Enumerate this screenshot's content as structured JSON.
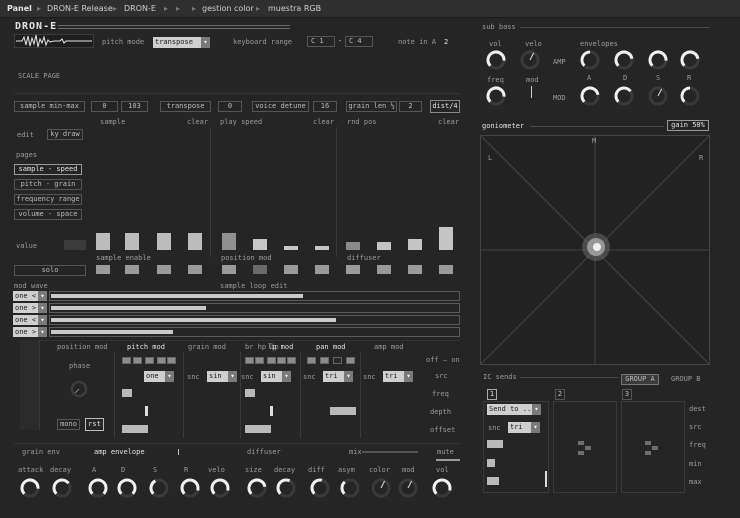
{
  "breadcrumb": {
    "root": "Panel",
    "items": [
      "DRON-E Release",
      "DRON-E",
      "",
      "",
      "gestion color",
      "muestra RGB"
    ]
  },
  "header": {
    "title": "DRON-E",
    "pitch_mode_label": "pitch mode",
    "pitch_mode": "transpose",
    "kbd_range_label": "keyboard range",
    "kbd_lo": "C 1",
    "kbd_hi": "C 4",
    "kbd_dash": "-",
    "note_label": "note in A",
    "note_val": "2",
    "scale_page": "SCALE PAGE"
  },
  "params": {
    "sample_minmax": "sample min-max",
    "smin": "0",
    "smax": "103",
    "transpose": "transpose",
    "transpose_val": "0",
    "voice_detune": "voice detune",
    "detune_val": "16",
    "grain_len": "grain len ½",
    "grain_len_val": "2",
    "dist": "dist/4"
  },
  "seq": {
    "sample": "sample",
    "play_speed": "play speed",
    "rnd_pos": "rnd pos",
    "clear": "clear",
    "edit": "edit",
    "kydraw": "ky draw",
    "pages": "pages",
    "page_items": [
      "sample - speed",
      "pitch - grain",
      "frequency range",
      "volume - space"
    ],
    "value": "value",
    "solo": "solo",
    "sample_enable": "sample enable",
    "position_mod": "position mod",
    "diffuser": "diffuser",
    "bar_values": [
      0.45,
      0.45,
      0.45,
      0.45,
      0.45,
      0.3,
      0.1,
      0.1,
      0.2,
      0.2,
      0.3,
      0.6
    ]
  },
  "modwave": {
    "label": "mod wave",
    "loop_label": "sample loop edit",
    "rows": [
      {
        "sel": "one <",
        "val": 0.62
      },
      {
        "sel": "one >",
        "val": 0.38
      },
      {
        "sel": "one <",
        "val": 0.7
      },
      {
        "sel": "one >",
        "val": 0.3
      }
    ]
  },
  "mods": {
    "position_mod": "position mod",
    "phase": "phase",
    "pitch_mod": "pitch mod",
    "grain_mod": "grain mod",
    "br_hp_lp": "br hp lp",
    "lp_mod": "lp mod",
    "pan_mod": "pan mod",
    "amp_mod": "amp mod",
    "off_on": "off – on",
    "src": "src",
    "freq": "freq",
    "depth": "depth",
    "offset": "offset",
    "mono": "mono",
    "rst": "rst",
    "sync": "snc",
    "wave1": "one",
    "wave2": "sin",
    "wave3": "sin",
    "wave4": "tri",
    "wave5": "tri"
  },
  "envrow": {
    "grain_env": "grain env",
    "amp_envelope": "amp envelope",
    "diffuser": "diffuser",
    "mix": "mix",
    "mute": "mute",
    "knobs": [
      "attack",
      "decay",
      "A",
      "D",
      "S",
      "R",
      "velo",
      "size",
      "decay",
      "diff",
      "asym",
      "color",
      "mod",
      "vol"
    ]
  },
  "subbass": {
    "title": "sub bass",
    "vol": "vol",
    "velo": "velo",
    "freq": "freq",
    "mod": "mod",
    "envelopes": "envelopes",
    "amp": "AMP",
    "modl": "MOD",
    "adsr": [
      "A",
      "D",
      "S",
      "R"
    ]
  },
  "gonio": {
    "title": "goniometer",
    "gain": "gain 50%",
    "L": "L",
    "M": "M",
    "R": "R"
  },
  "ic": {
    "title": "IC sends",
    "groupA": "GROUP A",
    "groupB": "GROUP B",
    "n1": "1",
    "n2": "2",
    "n3": "3",
    "send": "Send to ..",
    "snc": "snc",
    "tri": "tri",
    "labels": [
      "dest",
      "src",
      "freq",
      "min",
      "max"
    ]
  }
}
